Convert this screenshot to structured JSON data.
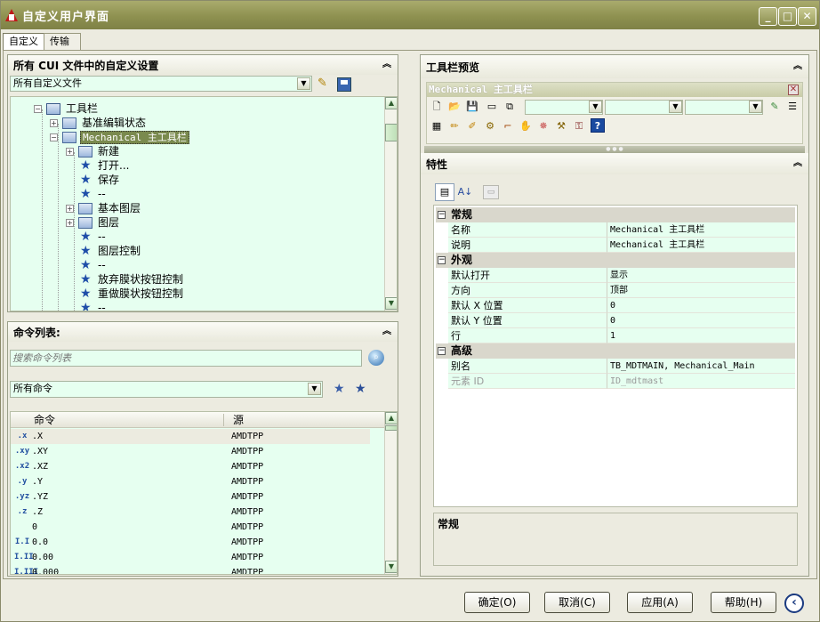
{
  "window": {
    "title": "自定义用户界面",
    "minimize": "_",
    "maximize": "□",
    "close": "✕"
  },
  "tabs": [
    {
      "label": "自定义"
    },
    {
      "label": "传输"
    }
  ],
  "cui_panel": {
    "title": "所有 CUI 文件中的自定义设置",
    "file_combo": "所有自定义文件",
    "tree": [
      {
        "label": "工具栏"
      },
      {
        "label": "基准编辑状态"
      },
      {
        "label": "Mechanical 主工具栏"
      },
      {
        "label": "新建"
      },
      {
        "label": "打开..."
      },
      {
        "label": "保存"
      },
      {
        "label": "--"
      },
      {
        "label": "基本图层"
      },
      {
        "label": "图层"
      },
      {
        "label": "--"
      },
      {
        "label": "图层控制"
      },
      {
        "label": "--"
      },
      {
        "label": "放弃膜状按钮控制"
      },
      {
        "label": "重做膜状按钮控制"
      },
      {
        "label": "--"
      }
    ]
  },
  "command_panel": {
    "title": "命令列表:",
    "search_placeholder": "搜索命令列表",
    "filter_combo": "所有命令",
    "columns": {
      "name": "命令",
      "source": "源"
    },
    "rows": [
      {
        "icon": ".x",
        "name": ".X",
        "source": "AMDTPP"
      },
      {
        "icon": ".xy",
        "name": ".XY",
        "source": "AMDTPP"
      },
      {
        "icon": ".x2",
        "name": ".XZ",
        "source": "AMDTPP"
      },
      {
        "icon": ".y",
        "name": ".Y",
        "source": "AMDTPP"
      },
      {
        "icon": ".yz",
        "name": ".YZ",
        "source": "AMDTPP"
      },
      {
        "icon": ".z",
        "name": ".Z",
        "source": "AMDTPP"
      },
      {
        "icon": "",
        "name": "0",
        "source": "AMDTPP"
      },
      {
        "icon": "I.I",
        "name": "0.0",
        "source": "AMDTPP"
      },
      {
        "icon": "I.II",
        "name": "0.00",
        "source": "AMDTPP"
      },
      {
        "icon": "I.III",
        "name": "0.000",
        "source": "AMDTPP"
      }
    ]
  },
  "toolbar_preview": {
    "title": "工具栏预览",
    "toolbar_name": "Mechanical 主工具栏",
    "grip": "● ● ●"
  },
  "properties": {
    "title": "特性",
    "categories": [
      {
        "label": "常规",
        "rows": [
          {
            "key": "名称",
            "value": "Mechanical 主工具栏"
          },
          {
            "key": "说明",
            "value": "Mechanical 主工具栏"
          }
        ]
      },
      {
        "label": "外观",
        "rows": [
          {
            "key": "默认打开",
            "value": "显示"
          },
          {
            "key": "方向",
            "value": "顶部"
          },
          {
            "key": "默认 X 位置",
            "value": "0"
          },
          {
            "key": "默认 Y 位置",
            "value": "0"
          },
          {
            "key": "行",
            "value": "1"
          }
        ]
      },
      {
        "label": "高级",
        "rows": [
          {
            "key": "别名",
            "value": "TB_MDTMAIN, Mechanical_Main"
          },
          {
            "key": "元素 ID",
            "value": "ID_mdtmast"
          }
        ]
      }
    ],
    "description_title": "常规"
  },
  "buttons": {
    "ok": "确定(O)",
    "cancel": "取消(C)",
    "apply": "应用(A)",
    "help": "帮助(H)"
  }
}
